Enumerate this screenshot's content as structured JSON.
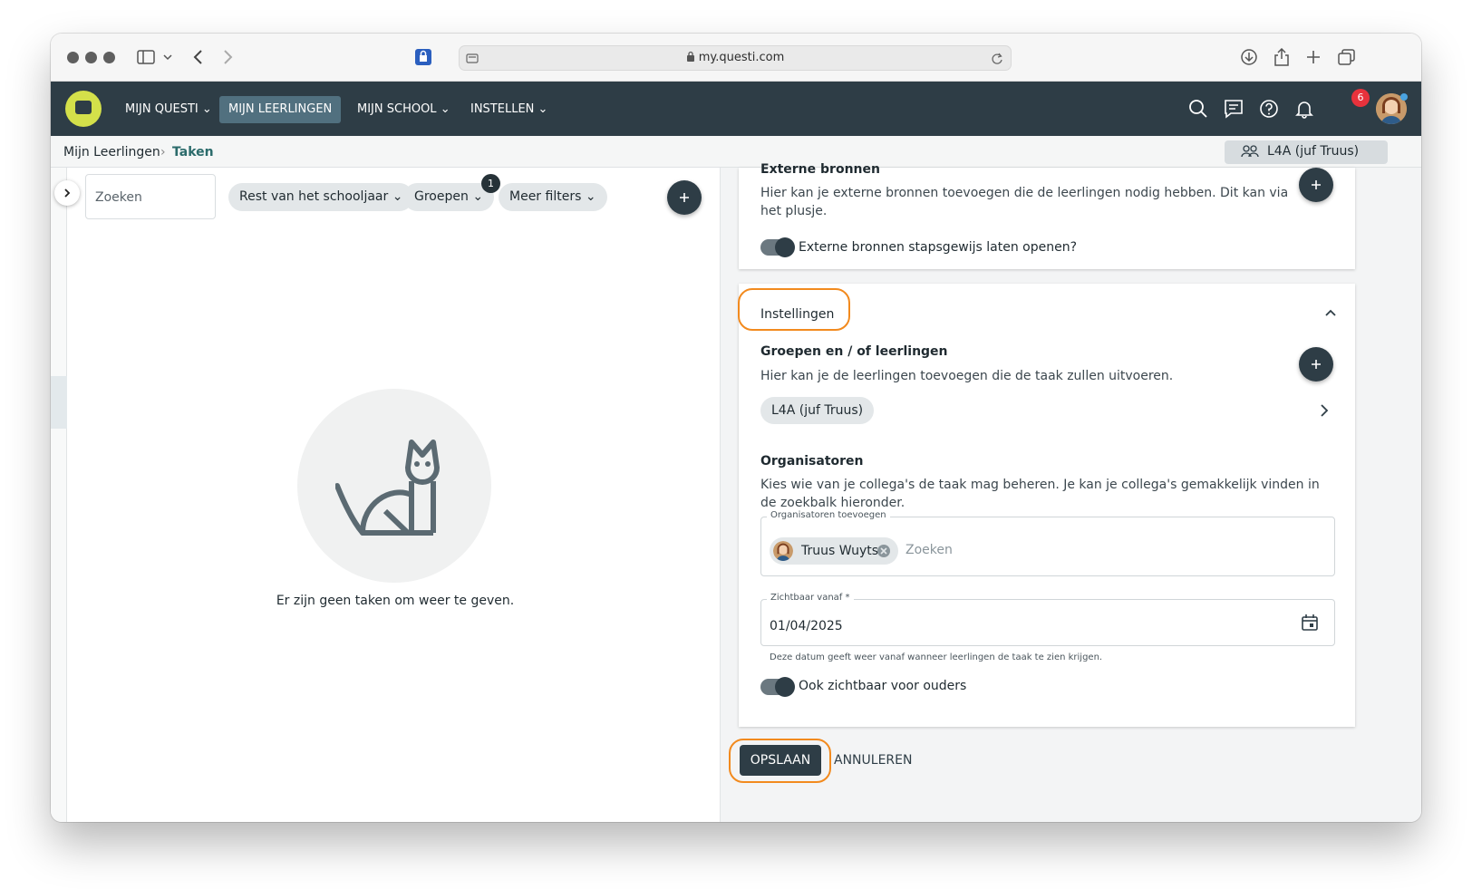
{
  "browser": {
    "url": "my.questi.com"
  },
  "nav": {
    "items": [
      "MIJN QUESTI",
      "MIJN LEERLINGEN",
      "MIJN SCHOOL",
      "INSTELLEN"
    ],
    "notifications": "6"
  },
  "breadcrumb": {
    "parent": "Mijn Leerlingen",
    "current": "Taken",
    "group": "L4A (juf Truus)"
  },
  "filters": {
    "search_placeholder": "Zoeken",
    "period": "Rest van het schooljaar",
    "groups": "Groepen",
    "groups_count": "1",
    "more": "Meer filters"
  },
  "empty_message": "Er zijn geen taken om weer te geven.",
  "externe": {
    "title": "Externe bronnen",
    "desc": "Hier kan je externe bronnen toevoegen die de leerlingen nodig hebben. Dit kan via het plusje.",
    "toggle_label": "Externe bronnen stapsgewijs laten openen?"
  },
  "settings": {
    "title": "Instellingen",
    "groups_title": "Groepen en / of leerlingen",
    "groups_desc": "Hier kan je de leerlingen toevoegen die de taak zullen uitvoeren.",
    "group_chip": "L4A (juf Truus)",
    "org_title": "Organisatoren",
    "org_desc": "Kies wie van je collega's de taak mag beheren. Je kan je collega's gemakkelijk vinden in de zoekbalk hieronder.",
    "org_label": "Organisatoren toevoegen",
    "org_person": "Truus Wuyts",
    "org_placeholder": "Zoeken",
    "visible_label": "Zichtbaar vanaf *",
    "visible_value": "01/04/2025",
    "visible_hint": "Deze datum geeft weer vanaf wanneer leerlingen de taak te zien krijgen.",
    "parents_label": "Ook zichtbaar voor ouders"
  },
  "actions": {
    "save": "OPSLAAN",
    "cancel": "ANNULEREN"
  }
}
